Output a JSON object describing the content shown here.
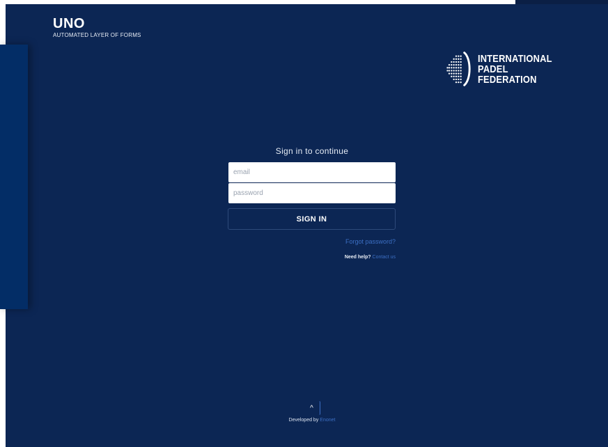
{
  "brand": {
    "title": "UNO",
    "subtitle": "AUTOMATED LAYER OF FORMS"
  },
  "federation": {
    "line1": "INTERNATIONAL",
    "line2": "PADEL",
    "line3": "FEDERATION"
  },
  "signin": {
    "heading": "Sign in to continue",
    "email_placeholder": "email",
    "password_placeholder": "password",
    "button_label": "SIGN IN",
    "forgot_label": "Forgot password?",
    "help_label": "Need help?",
    "help_link": "Contact us"
  },
  "footer": {
    "scroll_top_icon": "chevron-up-icon",
    "scroll_top_glyph": "^",
    "developed_label": "Developed by",
    "developer_name": "Enonet"
  },
  "colors": {
    "background": "#0c2654",
    "side_panel": "#032d66",
    "link": "#3c6fc4",
    "input_bg": "#ffffff"
  }
}
